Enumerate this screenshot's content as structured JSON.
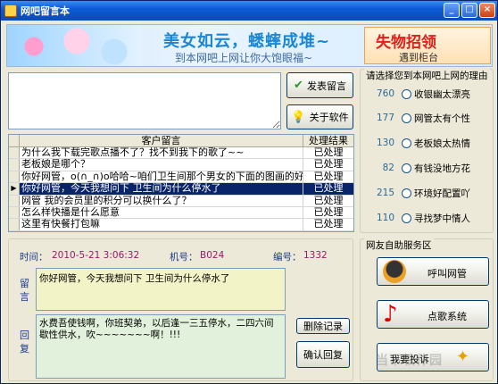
{
  "window": {
    "title": "网吧留言本"
  },
  "banner": {
    "headline": "美女如云，蟋蟀成堆~",
    "subline": "到本网吧上网让你大饱眼福~",
    "ad_title": "失物招领",
    "ad_sub": "遇到柜台"
  },
  "buttons": {
    "post": "发表留言",
    "about": "关于软件",
    "delete": "删除记录",
    "confirm": "确认回复"
  },
  "table": {
    "headers": [
      "客户留言",
      "处理结果"
    ],
    "rows": [
      {
        "msg": "为什么我下载完歌点播不了？找不到我下的歌了~~",
        "status": "已处理",
        "selected": false
      },
      {
        "msg": "老板娘是哪个？",
        "status": "已处理",
        "selected": false
      },
      {
        "msg": "你好网管，o(∩_∩)o哈哈~咱们卫生间那个男女的下面的图画的好好玩",
        "status": "已处理",
        "selected": false
      },
      {
        "msg": "你好网管，今天我想问下 卫生间为什么停水了",
        "status": "已处理",
        "selected": true
      },
      {
        "msg": "网管  我的会员里的积分可以换什么了？",
        "status": "已处理",
        "selected": false
      },
      {
        "msg": "怎么样快播是什么愿意",
        "status": "已处理",
        "selected": false
      },
      {
        "msg": "这里有快餐打包嘛",
        "status": "已处理",
        "selected": false
      }
    ]
  },
  "reasons": {
    "title": "请选择您到本网吧上网的理由",
    "items": [
      {
        "count": "760",
        "label": "收银幽太漂亮"
      },
      {
        "count": "177",
        "label": "网管太有个性"
      },
      {
        "count": "130",
        "label": "老板娘太热情"
      },
      {
        "count": "82",
        "label": "有钱没地方花"
      },
      {
        "count": "215",
        "label": "环境好配置吖"
      },
      {
        "count": "110",
        "label": "寻找梦中情人"
      }
    ]
  },
  "detail": {
    "time_label": "时间：",
    "time_value": "2010-5-21 3:06:32",
    "machine_label": "机号：",
    "machine_value": "B024",
    "number_label": "编号：",
    "number_value": "1332",
    "msg_side": "留言",
    "reply_side": "回复",
    "message": "你好网管，今天我想问下 卫生间为什么停水了",
    "reply": "水费吾使钱啊，你班契弟，以后逢一三五停水，二四六间歇性供水，吹~~~~~~~啊！!!!"
  },
  "service": {
    "title": "网友自助服务区",
    "call": "呼叫网管",
    "song": "点歌系统",
    "complain": "我要投诉"
  },
  "watermark": "当下软件园",
  "colors": {
    "title_bar": "#0b5bd6",
    "selected_row": "#0a246a",
    "message_bg": "#f3f3c8",
    "reply_bg": "#e1f1db"
  }
}
